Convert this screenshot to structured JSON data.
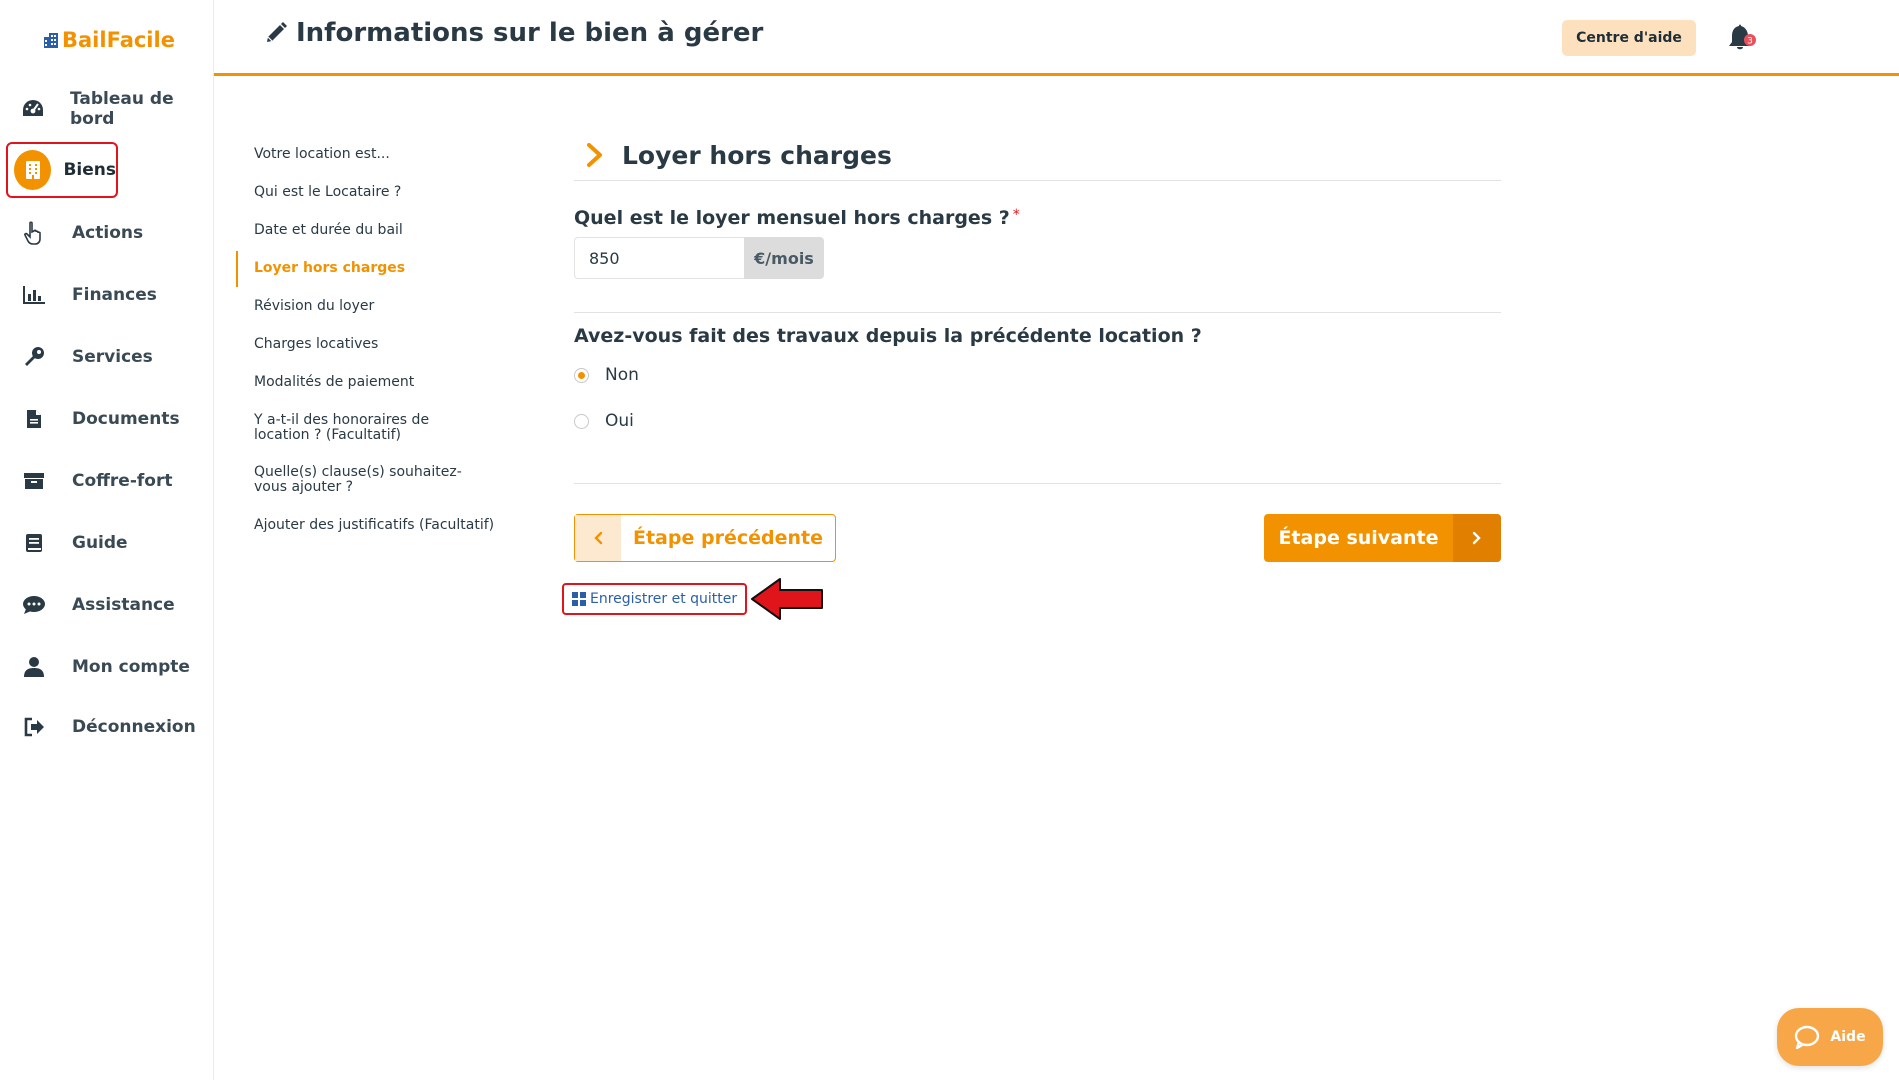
{
  "app": {
    "logo_text": "BailFacile"
  },
  "colors": {
    "accent": "#f39200",
    "accent_light": "#fde1bf",
    "highlight_red": "#e0151c",
    "link_blue": "#2b5ea8"
  },
  "sidebar": {
    "items": [
      {
        "label": "Tableau de bord",
        "icon": "dashboard-icon"
      },
      {
        "label": "Biens",
        "icon": "building-icon",
        "active": true
      },
      {
        "label": "Actions",
        "icon": "pointer-hand-icon"
      },
      {
        "label": "Finances",
        "icon": "bar-chart-icon"
      },
      {
        "label": "Services",
        "icon": "wrench-icon"
      },
      {
        "label": "Documents",
        "icon": "document-icon"
      },
      {
        "label": "Coffre-fort",
        "icon": "archive-icon"
      },
      {
        "label": "Guide",
        "icon": "book-icon"
      },
      {
        "label": "Assistance",
        "icon": "chat-icon"
      },
      {
        "label": "Mon compte",
        "icon": "user-icon"
      },
      {
        "label": "Déconnexion",
        "icon": "logout-icon"
      }
    ]
  },
  "header": {
    "title": "Informations sur le bien à gérer",
    "help_label": "Centre d'aide",
    "notification_count": "3"
  },
  "steps": [
    {
      "label": "Votre location est..."
    },
    {
      "label": "Qui est le Locataire ?"
    },
    {
      "label": "Date et durée du bail"
    },
    {
      "label": "Loyer hors charges",
      "active": true
    },
    {
      "label": "Révision du loyer"
    },
    {
      "label": "Charges locatives"
    },
    {
      "label": "Modalités de paiement"
    },
    {
      "label": "Y a-t-il des honoraires de location ? (Facultatif)"
    },
    {
      "label": "Quelle(s) clause(s) souhaitez-vous ajouter ?"
    },
    {
      "label": "Ajouter des justificatifs (Facultatif)"
    }
  ],
  "form": {
    "section_title": "Loyer hors charges",
    "rent_question": "Quel est le loyer mensuel hors charges ?",
    "required_mark": "*",
    "rent_value": "850",
    "rent_unit": "€/mois",
    "works_question": "Avez-vous fait des travaux depuis la précédente location ?",
    "options": [
      {
        "label": "Non",
        "checked": true
      },
      {
        "label": "Oui",
        "checked": false
      }
    ],
    "prev_label": "Étape précédente",
    "next_label": "Étape suivante",
    "save_label": "Enregistrer et quitter"
  },
  "floating": {
    "aide_label": "Aide"
  }
}
